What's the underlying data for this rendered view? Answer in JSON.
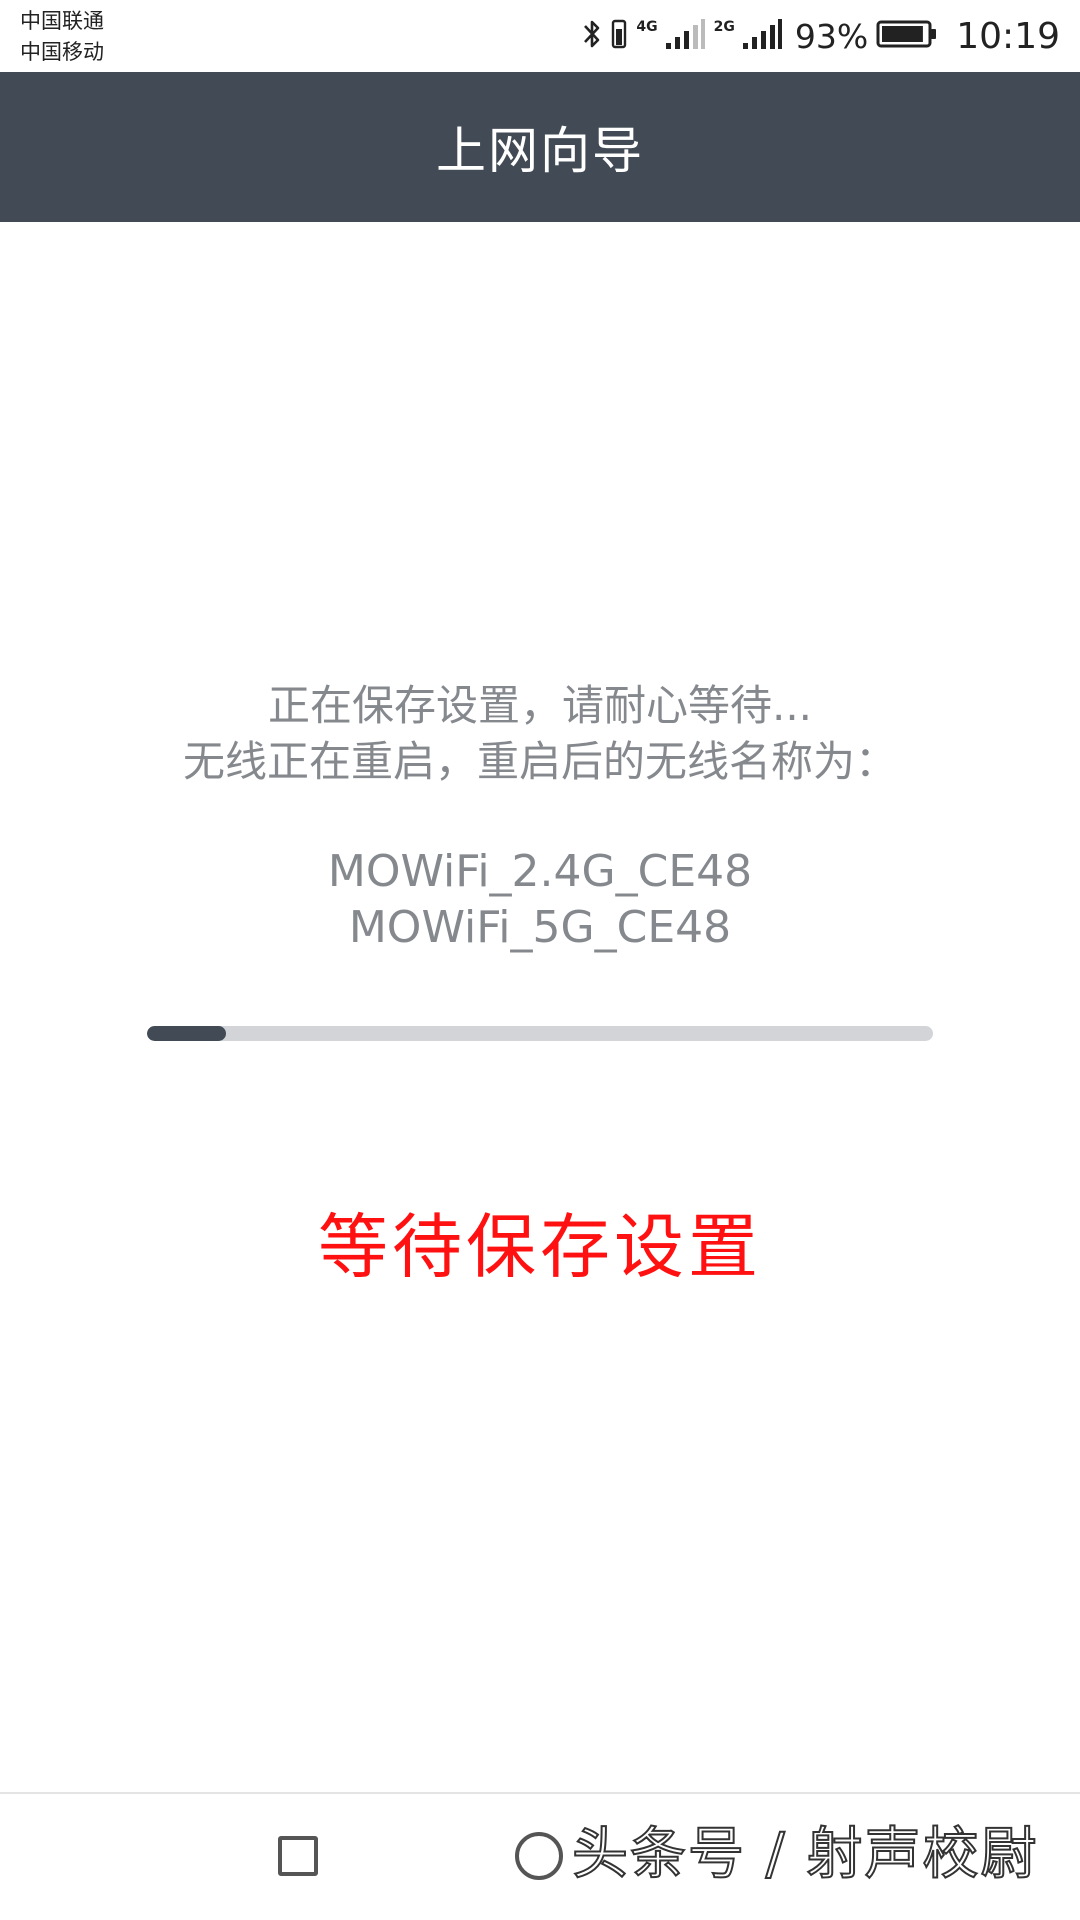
{
  "status_bar": {
    "carrier_1": "中国联通",
    "carrier_2": "中国移动",
    "network_1": "4G",
    "network_2": "2G",
    "battery_percent": "93%",
    "battery_level": 0.93,
    "time": "10:19",
    "icons": [
      "bluetooth-icon",
      "vibrate-icon",
      "signal-icon",
      "signal-icon",
      "battery-icon"
    ]
  },
  "header": {
    "title": "上网向导",
    "background": "#424b55"
  },
  "main": {
    "message_line_1": "正在保存设置，请耐心等待...",
    "message_line_2": "无线正在重启，重启后的无线名称为：",
    "ssid_24g": "MOWiFi_2.4G_CE48",
    "ssid_5g": "MOWiFi_5G_CE48",
    "progress_percent": 10,
    "caption": "等待保存设置",
    "caption_color": "#ff1111",
    "text_color": "#85898e"
  },
  "nav_bar": {
    "icons": [
      "recents-icon",
      "home-icon"
    ],
    "watermark": "头条号 / 射声校尉"
  }
}
